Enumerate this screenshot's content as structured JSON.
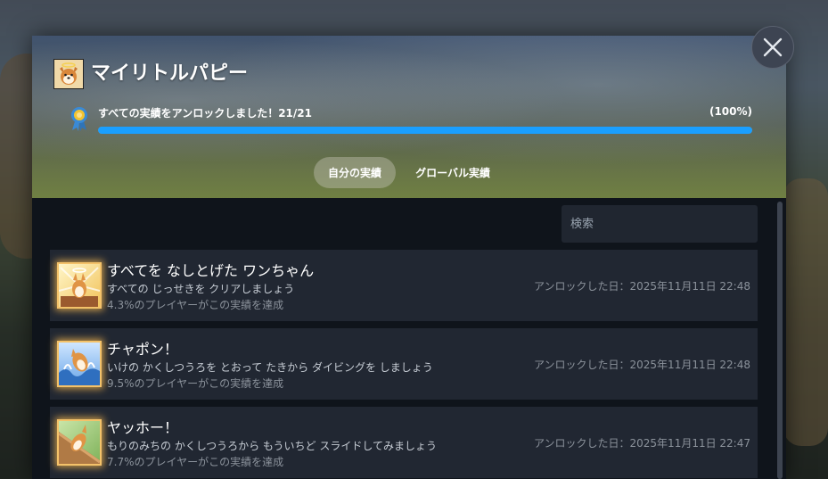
{
  "game": {
    "title": "マイリトルパピー",
    "icon": "corgi-game-icon"
  },
  "progress": {
    "label": "すべての実績をアンロックしました！21/21",
    "percent_label": "(100%)",
    "fraction": 1.0,
    "bar_color": "#1a9fff"
  },
  "tabs": [
    {
      "label": "自分の実績",
      "active": true
    },
    {
      "label": "グローバル実績",
      "active": false
    }
  ],
  "search": {
    "placeholder": "検索",
    "value": ""
  },
  "achievements": [
    {
      "name": "すべてを なしとげた ワンちゃん",
      "description": "すべての じっせきを クリアしましょう",
      "rate": "4.3%のプレイヤーがこの実績を達成",
      "unlocked": "アンロックした日：2025年11月11日 22:48",
      "icon": "corgi-halo-icon"
    },
    {
      "name": "チャポン！",
      "description": "いけの かくしつうろを とおって たきから ダイビングを しましょう",
      "rate": "9.5%のプレイヤーがこの実績を達成",
      "unlocked": "アンロックした日：2025年11月11日 22:48",
      "icon": "corgi-splash-icon"
    },
    {
      "name": "ヤッホー！",
      "description": "もりのみちの かくしつうろから もういちど スライドしてみましょう",
      "rate": "7.7%のプレイヤーがこの実績を達成",
      "unlocked": "アンロックした日：2025年11月11日 22:47",
      "icon": "corgi-slide-icon"
    }
  ],
  "close_icon": "close-icon"
}
